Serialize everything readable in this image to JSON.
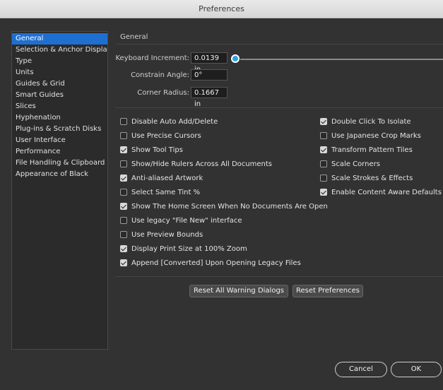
{
  "window": {
    "title": "Preferences"
  },
  "sidebar": {
    "items": [
      {
        "label": "General",
        "selected": true
      },
      {
        "label": "Selection & Anchor Display",
        "selected": false
      },
      {
        "label": "Type",
        "selected": false
      },
      {
        "label": "Units",
        "selected": false
      },
      {
        "label": "Guides & Grid",
        "selected": false
      },
      {
        "label": "Smart Guides",
        "selected": false
      },
      {
        "label": "Slices",
        "selected": false
      },
      {
        "label": "Hyphenation",
        "selected": false
      },
      {
        "label": "Plug-ins & Scratch Disks",
        "selected": false
      },
      {
        "label": "User Interface",
        "selected": false
      },
      {
        "label": "Performance",
        "selected": false
      },
      {
        "label": "File Handling & Clipboard",
        "selected": false
      },
      {
        "label": "Appearance of Black",
        "selected": false
      }
    ]
  },
  "main": {
    "section_title": "General",
    "fields": {
      "keyboard_increment": {
        "label": "Keyboard Increment:",
        "value": "0.0139 in"
      },
      "constrain_angle": {
        "label": "Constrain Angle:",
        "value": "0°"
      },
      "corner_radius": {
        "label": "Corner Radius:",
        "value": "0.1667 in"
      }
    },
    "left_options": [
      {
        "label": "Disable Auto Add/Delete",
        "checked": false
      },
      {
        "label": "Use Precise Cursors",
        "checked": false
      },
      {
        "label": "Show Tool Tips",
        "checked": true
      },
      {
        "label": "Show/Hide Rulers Across All Documents",
        "checked": false
      },
      {
        "label": "Anti-aliased Artwork",
        "checked": true
      },
      {
        "label": "Select Same Tint %",
        "checked": false
      },
      {
        "label": "Show The Home Screen When No Documents Are Open",
        "checked": true
      },
      {
        "label": "Use legacy \"File New\" interface",
        "checked": false
      },
      {
        "label": "Use Preview Bounds",
        "checked": false
      },
      {
        "label": "Display Print Size at 100% Zoom",
        "checked": true
      },
      {
        "label": "Append [Converted] Upon Opening Legacy Files",
        "checked": true
      }
    ],
    "right_options": [
      {
        "label": "Double Click To Isolate",
        "checked": true
      },
      {
        "label": "Use Japanese Crop Marks",
        "checked": false
      },
      {
        "label": "Transform Pattern Tiles",
        "checked": true
      },
      {
        "label": "Scale Corners",
        "checked": false
      },
      {
        "label": "Scale Strokes & Effects",
        "checked": false
      },
      {
        "label": "Enable Content Aware Defaults",
        "checked": true
      }
    ],
    "buttons": {
      "reset_warnings": "Reset All Warning Dialogs",
      "reset_prefs": "Reset Preferences"
    }
  },
  "footer": {
    "cancel": "Cancel",
    "ok": "OK"
  },
  "colors": {
    "background": "#323232",
    "selection": "#1f6fd1",
    "slider_thumb": "#29a3e2"
  }
}
